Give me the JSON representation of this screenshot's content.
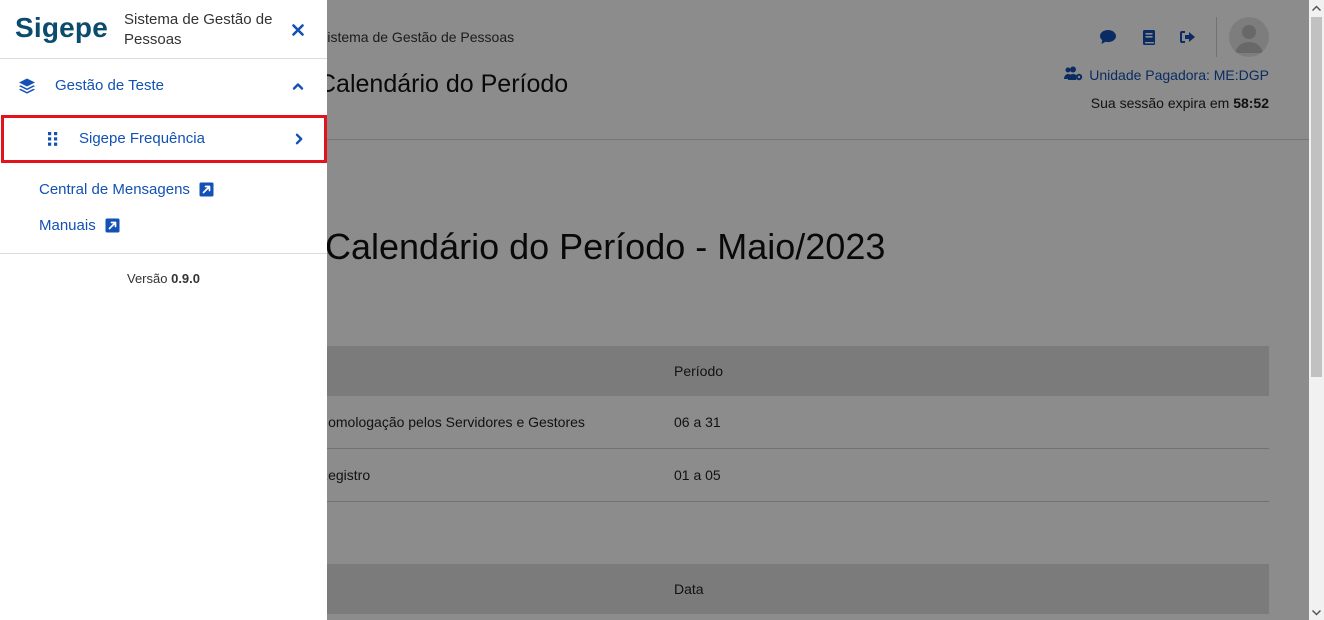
{
  "header": {
    "breadcrumb": "Sistema de Gestão de Pessoas",
    "page_title": "Calendário do Período",
    "unit_label": "Unidade Pagadora: ME:DGP",
    "session_prefix": "Sua sessão expira em",
    "session_time": "58:52",
    "icons": [
      "chat-icon",
      "book-icon",
      "sign-out-icon",
      "user-avatar-icon"
    ]
  },
  "main": {
    "heading": "Calendário do Período - Maio/2023",
    "table1": {
      "col_header": "Período",
      "rows": [
        {
          "desc": "Homologação pelos Servidores e Gestores",
          "period": "06 a 31"
        },
        {
          "desc": "Registro",
          "period": "01 a 05"
        }
      ]
    },
    "table2": {
      "col_header": "Data"
    }
  },
  "sidemenu": {
    "logo": "Sigepe",
    "subtitle": "Sistema de Gestão de Pessoas",
    "group_label": "Gestão de Teste",
    "subitem_label": "Sigepe Frequência",
    "links": {
      "central": "Central de Mensagens",
      "manuais": "Manuais"
    },
    "version_label": "Versão",
    "version_value": "0.9.0"
  },
  "colors": {
    "brand": "#0b4b6e",
    "link": "#1351b4",
    "highlight": "#e1141c"
  }
}
